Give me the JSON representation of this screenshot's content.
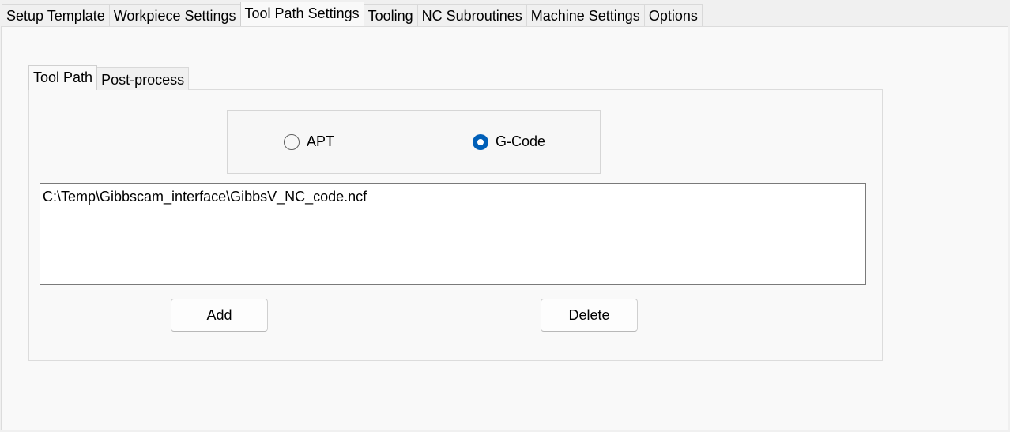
{
  "top_tabs": [
    {
      "label": "Setup Template",
      "active": false
    },
    {
      "label": "Workpiece Settings",
      "active": false
    },
    {
      "label": "Tool Path Settings",
      "active": true
    },
    {
      "label": "Tooling",
      "active": false
    },
    {
      "label": "NC Subroutines",
      "active": false
    },
    {
      "label": "Machine Settings",
      "active": false
    },
    {
      "label": "Options",
      "active": false
    }
  ],
  "inner_tabs": [
    {
      "label": "Tool Path",
      "active": true
    },
    {
      "label": "Post-process",
      "active": false
    }
  ],
  "output_format": {
    "options": [
      {
        "label": "APT",
        "checked": false
      },
      {
        "label": "G-Code",
        "checked": true
      }
    ],
    "selected": "G-Code"
  },
  "file_list": {
    "items": [
      "C:\\Temp\\Gibbscam_interface\\GibbsV_NC_code.ncf"
    ]
  },
  "buttons": {
    "add_label": "Add",
    "delete_label": "Delete"
  },
  "colors": {
    "accent": "#005fb8",
    "window_bg": "#f0f0f0",
    "panel_bg": "#f9f9f9"
  }
}
